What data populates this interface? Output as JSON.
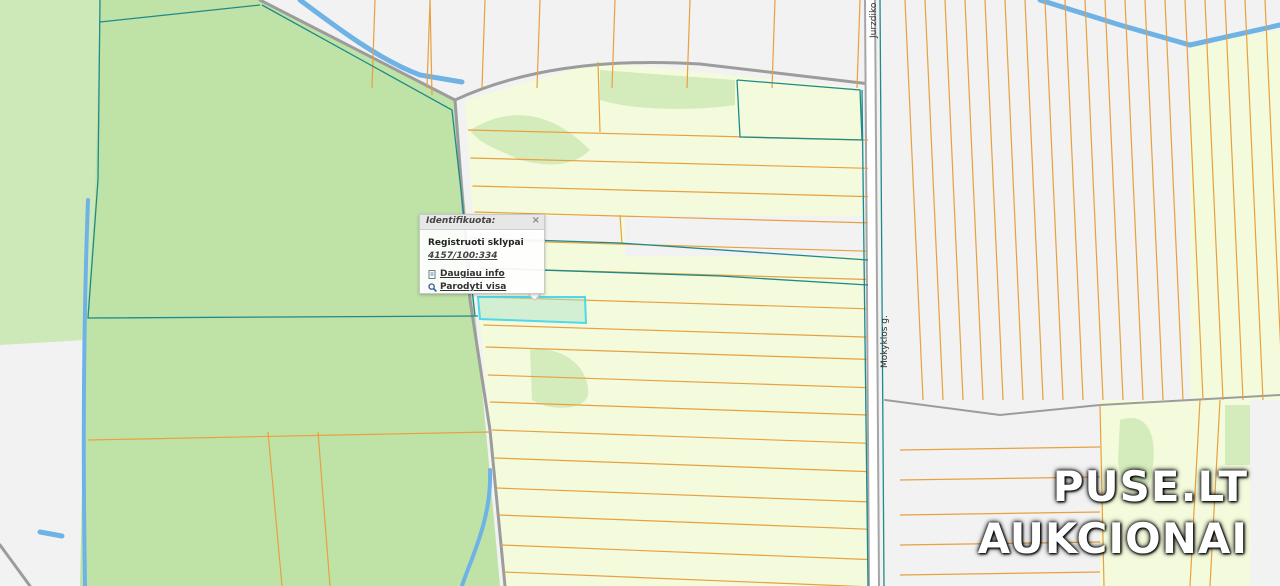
{
  "map": {
    "streets": [
      "Jurzdiko",
      "Mokyklos g."
    ],
    "colors": {
      "background": "#f2f2f2",
      "forest": "#bfe3a6",
      "field": "#f3fbdc",
      "grove": "#d4ecbc",
      "parcel_line": "#e8a040",
      "cadastral_line": "#1e8a8a",
      "water": "#6fb3e6",
      "road": "#9c9c9c",
      "selection": "#4fd8e8"
    }
  },
  "popup": {
    "title": "Identifikuota:",
    "layer": "Registruoti sklypai",
    "parcel_id": "4157/100:334",
    "more_info": "Daugiau info",
    "show_all": "Parodyti visa"
  },
  "watermark": {
    "line1": "PUSE.LT",
    "line2": "AUKCIONAI"
  }
}
